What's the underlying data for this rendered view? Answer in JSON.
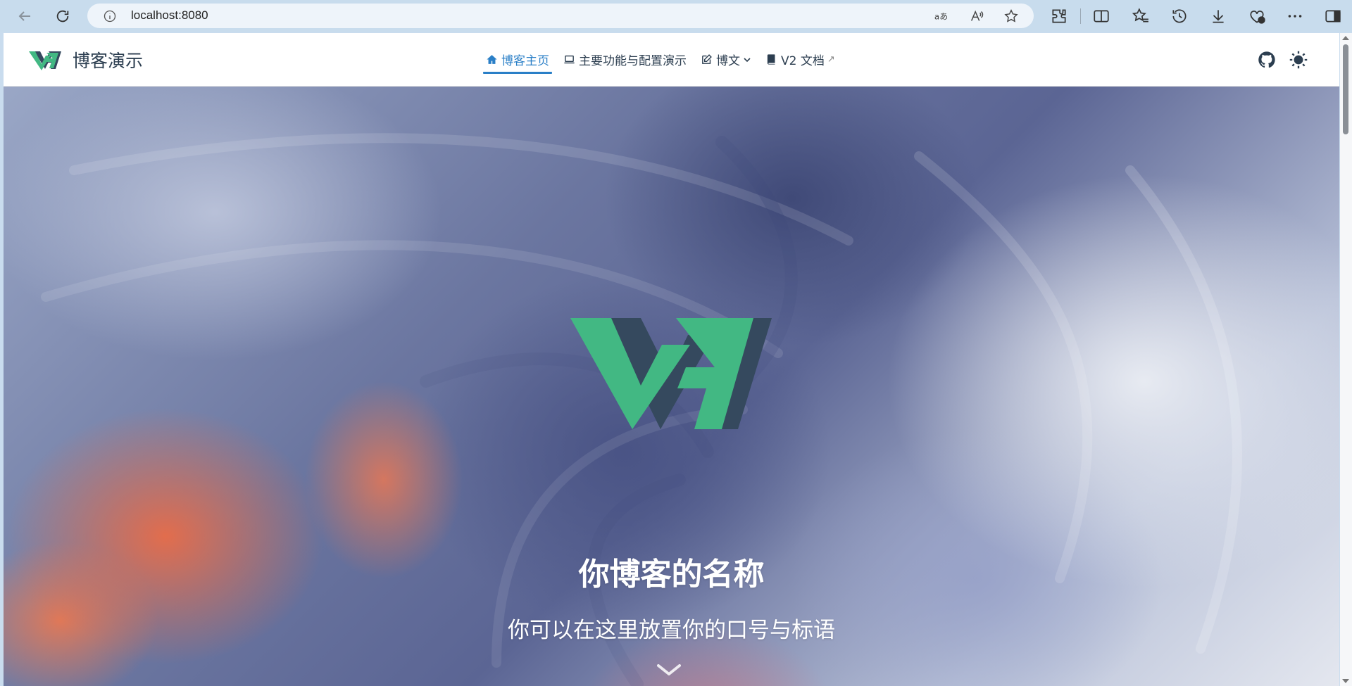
{
  "browser": {
    "url": "localhost:8080",
    "icons": [
      "back-icon",
      "refresh-icon",
      "site-info-icon",
      "translate-icon",
      "read-aloud-icon",
      "favorite-star-icon",
      "extensions-icon",
      "split-screen-icon",
      "favorites-icon",
      "history-icon",
      "downloads-icon",
      "browser-essentials-icon",
      "more-icon",
      "sidebar-icon"
    ]
  },
  "site": {
    "brand": "博客演示",
    "nav": [
      {
        "label": "博客主页",
        "icon": "home-icon",
        "active": true
      },
      {
        "label": "主要功能与配置演示",
        "icon": "laptop-icon",
        "active": false
      },
      {
        "label": "博文",
        "icon": "edit-icon",
        "active": false,
        "dropdown": true
      },
      {
        "label": "V2 文档",
        "icon": "book-icon",
        "active": false,
        "external": true,
        "external_mark": "↗"
      }
    ],
    "right_icons": [
      "github-icon",
      "sun-icon"
    ]
  },
  "hero": {
    "title": "你博客的名称",
    "tagline": "你可以在这里放置你的口号与标语"
  },
  "colors": {
    "accent": "#2a7fc7",
    "logo_green": "#42b883",
    "logo_dark": "#35495e",
    "chrome": "#c8dced"
  }
}
